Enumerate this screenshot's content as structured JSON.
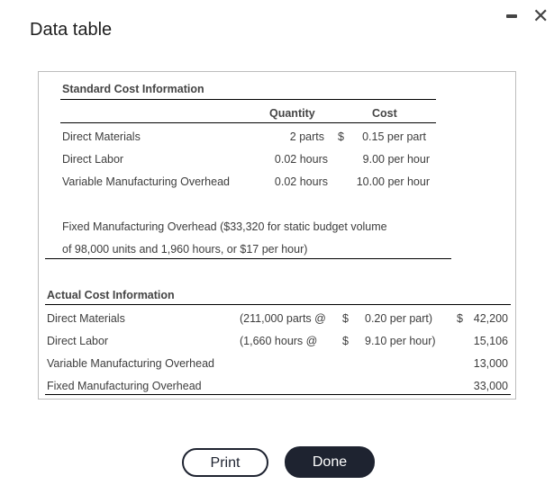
{
  "window": {
    "title": "Data table",
    "minimize_icon": "minimize-icon",
    "close_icon": "close-icon",
    "close_glyph": "✕"
  },
  "standard": {
    "heading": "Standard Cost Information",
    "col_quantity": "Quantity",
    "col_cost": "Cost",
    "rows": [
      {
        "label": "Direct Materials",
        "quantity": "2 parts",
        "currency": "$",
        "cost": "0.15 per part"
      },
      {
        "label": "Direct Labor",
        "quantity": "0.02 hours",
        "currency": "",
        "cost": "9.00 per hour"
      },
      {
        "label": "Variable Manufacturing Overhead",
        "quantity": "0.02 hours",
        "currency": "",
        "cost": "10.00 per hour"
      }
    ],
    "fixed_note_line1": "Fixed Manufacturing Overhead ($33,320 for static budget volume",
    "fixed_note_line2": "of 98,000 units and 1,960 hours, or $17 per hour)"
  },
  "actual": {
    "heading": "Actual Cost Information",
    "rows": [
      {
        "label": "Direct Materials",
        "detail": "(211,000 parts @",
        "currency": "$",
        "rate": "0.20 per part)",
        "total_currency": "$",
        "total": "42,200"
      },
      {
        "label": "Direct Labor",
        "detail": "(1,660 hours @",
        "currency": "$",
        "rate": "9.10 per hour)",
        "total_currency": "",
        "total": "15,106"
      },
      {
        "label": "Variable Manufacturing Overhead",
        "detail": "",
        "currency": "",
        "rate": "",
        "total_currency": "",
        "total": "13,000"
      },
      {
        "label": "Fixed Manufacturing Overhead",
        "detail": "",
        "currency": "",
        "rate": "",
        "total_currency": "",
        "total": "33,000"
      }
    ]
  },
  "buttons": {
    "print": "Print",
    "done": "Done"
  }
}
